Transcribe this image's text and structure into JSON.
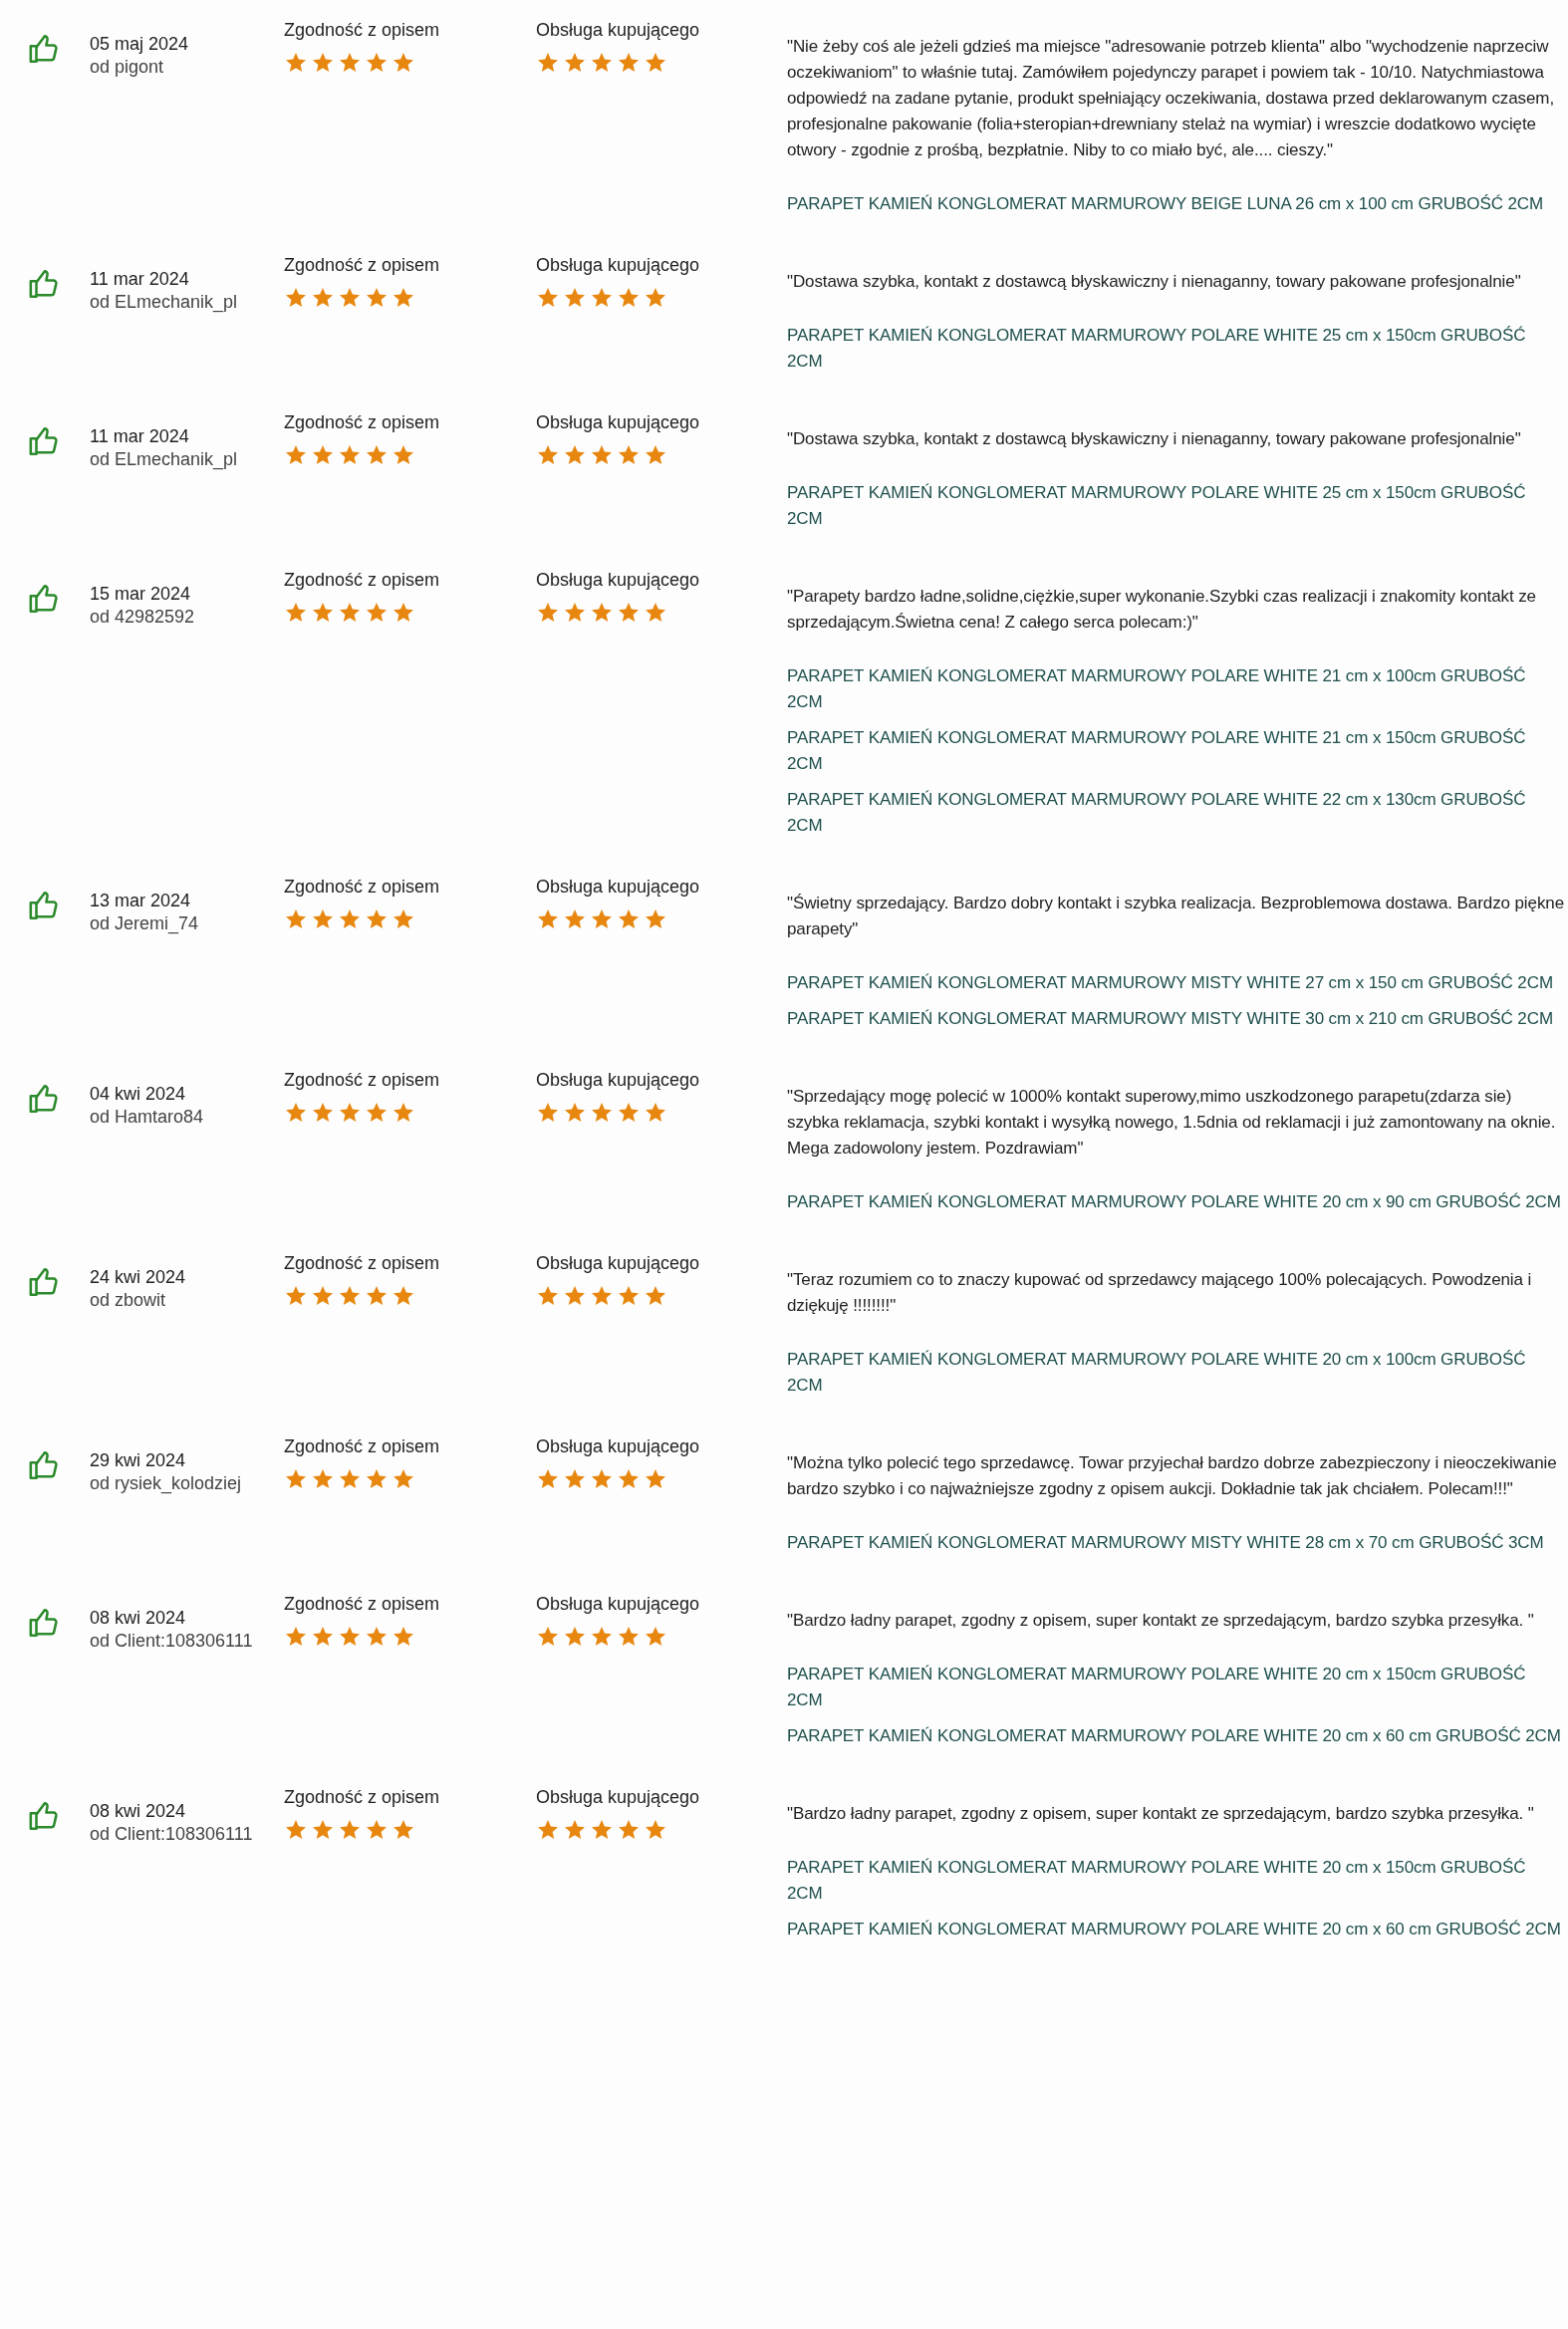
{
  "reviews": [
    {
      "date": "05 maj 2024",
      "author": "od pigont",
      "ratings": [
        {
          "label": "Zgodność z opisem",
          "stars": 5
        },
        {
          "label": "Obsługa kupującego",
          "stars": 5
        }
      ],
      "comment": "\"Nie żeby coś ale jeżeli gdzieś ma miejsce \"adresowanie potrzeb klienta\" albo \"wychodzenie naprzeciw oczekiwaniom\" to właśnie tutaj. Zamówiłem pojedynczy parapet i powiem tak - 10/10. Natychmiastowa odpowiedź na zadane pytanie, produkt spełniający oczekiwania, dostawa przed deklarowanym czasem, profesjonalne pakowanie (folia+steropian+drewniany stelaż na wymiar) i wreszcie dodatkowo wycięte otwory - zgodnie z prośbą, bezpłatnie. Niby to co miało być, ale.... cieszy.\"",
      "products": [
        "PARAPET KAMIEŃ KONGLOMERAT MARMUROWY BEIGE LUNA 26 cm x 100 cm GRUBOŚĆ 2CM"
      ]
    },
    {
      "date": "11 mar 2024",
      "author": "od ELmechanik_pl",
      "ratings": [
        {
          "label": "Zgodność z opisem",
          "stars": 5
        },
        {
          "label": "Obsługa kupującego",
          "stars": 5
        }
      ],
      "comment": "\"Dostawa szybka, kontakt z dostawcą błyskawiczny i nienaganny, towary pakowane profesjonalnie\"",
      "products": [
        "PARAPET KAMIEŃ KONGLOMERAT MARMUROWY POLARE WHITE 25 cm x 150cm GRUBOŚĆ 2CM"
      ]
    },
    {
      "date": "11 mar 2024",
      "author": "od ELmechanik_pl",
      "ratings": [
        {
          "label": "Zgodność z opisem",
          "stars": 5
        },
        {
          "label": "Obsługa kupującego",
          "stars": 5
        }
      ],
      "comment": "\"Dostawa szybka, kontakt z dostawcą błyskawiczny i nienaganny, towary pakowane profesjonalnie\"",
      "products": [
        "PARAPET KAMIEŃ KONGLOMERAT MARMUROWY POLARE WHITE 25 cm x 150cm GRUBOŚĆ 2CM"
      ]
    },
    {
      "date": "15 mar 2024",
      "author": "od 42982592",
      "ratings": [
        {
          "label": "Zgodność z opisem",
          "stars": 5
        },
        {
          "label": "Obsługa kupującego",
          "stars": 5
        }
      ],
      "comment": "\"Parapety bardzo ładne,solidne,ciężkie,super wykonanie.Szybki czas realizacji i znakomity kontakt ze sprzedającym.Świetna cena! Z całego serca polecam:)\"",
      "products": [
        "PARAPET KAMIEŃ KONGLOMERAT MARMUROWY POLARE WHITE 21 cm x 100cm GRUBOŚĆ 2CM",
        "PARAPET KAMIEŃ KONGLOMERAT MARMUROWY POLARE WHITE 21 cm x 150cm GRUBOŚĆ 2CM",
        "PARAPET KAMIEŃ KONGLOMERAT MARMUROWY POLARE WHITE 22 cm x 130cm GRUBOŚĆ 2CM"
      ]
    },
    {
      "date": "13 mar 2024",
      "author": "od Jeremi_74",
      "ratings": [
        {
          "label": "Zgodność z opisem",
          "stars": 5
        },
        {
          "label": "Obsługa kupującego",
          "stars": 5
        }
      ],
      "comment": "\"Świetny sprzedający. Bardzo dobry kontakt i szybka realizacja. Bezproblemowa dostawa. Bardzo piękne parapety\"",
      "products": [
        "PARAPET KAMIEŃ KONGLOMERAT MARMUROWY MISTY WHITE 27 cm x 150 cm GRUBOŚĆ 2CM",
        "PARAPET KAMIEŃ KONGLOMERAT MARMUROWY MISTY WHITE 30 cm x 210 cm GRUBOŚĆ 2CM"
      ]
    },
    {
      "date": "04 kwi 2024",
      "author": "od Hamtaro84",
      "ratings": [
        {
          "label": "Zgodność z opisem",
          "stars": 5
        },
        {
          "label": "Obsługa kupującego",
          "stars": 5
        }
      ],
      "comment": "\"Sprzedający mogę polecić w 1000% kontakt superowy,mimo uszkodzonego parapetu(zdarza sie) szybka reklamacja, szybki kontakt i wysyłką nowego, 1.5dnia od reklamacji i już zamontowany na oknie. Mega zadowolony jestem. Pozdrawiam\"",
      "products": [
        "PARAPET KAMIEŃ KONGLOMERAT MARMUROWY POLARE WHITE 20 cm x 90 cm GRUBOŚĆ 2CM"
      ]
    },
    {
      "date": "24 kwi 2024",
      "author": "od zbowit",
      "ratings": [
        {
          "label": "Zgodność z opisem",
          "stars": 5
        },
        {
          "label": "Obsługa kupującego",
          "stars": 5
        }
      ],
      "comment": "\"Teraz rozumiem co to znaczy kupować od sprzedawcy mającego 100% polecających. Powodzenia i dziękuję !!!!!!!!\"",
      "products": [
        "PARAPET KAMIEŃ KONGLOMERAT MARMUROWY POLARE WHITE 20 cm x 100cm GRUBOŚĆ 2CM"
      ]
    },
    {
      "date": "29 kwi 2024",
      "author": "od rysiek_kolodziej",
      "ratings": [
        {
          "label": "Zgodność z opisem",
          "stars": 5
        },
        {
          "label": "Obsługa kupującego",
          "stars": 5
        }
      ],
      "comment": "\"Można tylko polecić tego sprzedawcę. Towar przyjechał bardzo dobrze zabezpieczony i nieoczekiwanie bardzo szybko i co najważniejsze zgodny z opisem aukcji. Dokładnie tak jak chciałem. Polecam!!!\"",
      "products": [
        "PARAPET KAMIEŃ KONGLOMERAT MARMUROWY MISTY WHITE 28 cm x 70 cm GRUBOŚĆ 3CM"
      ]
    },
    {
      "date": "08 kwi 2024",
      "author": "od Client:108306111",
      "ratings": [
        {
          "label": "Zgodność z opisem",
          "stars": 5
        },
        {
          "label": "Obsługa kupującego",
          "stars": 5
        }
      ],
      "comment": "\"Bardzo ładny parapet, zgodny z opisem, super kontakt ze sprzedającym, bardzo szybka przesyłka. \"",
      "products": [
        "PARAPET KAMIEŃ KONGLOMERAT MARMUROWY POLARE WHITE 20 cm x 150cm GRUBOŚĆ 2CM",
        "PARAPET KAMIEŃ KONGLOMERAT MARMUROWY POLARE WHITE 20 cm x 60 cm GRUBOŚĆ 2CM"
      ]
    },
    {
      "date": "08 kwi 2024",
      "author": "od Client:108306111",
      "ratings": [
        {
          "label": "Zgodność z opisem",
          "stars": 5
        },
        {
          "label": "Obsługa kupującego",
          "stars": 5
        }
      ],
      "comment": "\"Bardzo ładny parapet, zgodny z opisem, super kontakt ze sprzedającym, bardzo szybka przesyłka. \"",
      "products": [
        "PARAPET KAMIEŃ KONGLOMERAT MARMUROWY POLARE WHITE 20 cm x 150cm GRUBOŚĆ 2CM",
        "PARAPET KAMIEŃ KONGLOMERAT MARMUROWY POLARE WHITE 20 cm x 60 cm GRUBOŚĆ 2CM"
      ]
    }
  ]
}
